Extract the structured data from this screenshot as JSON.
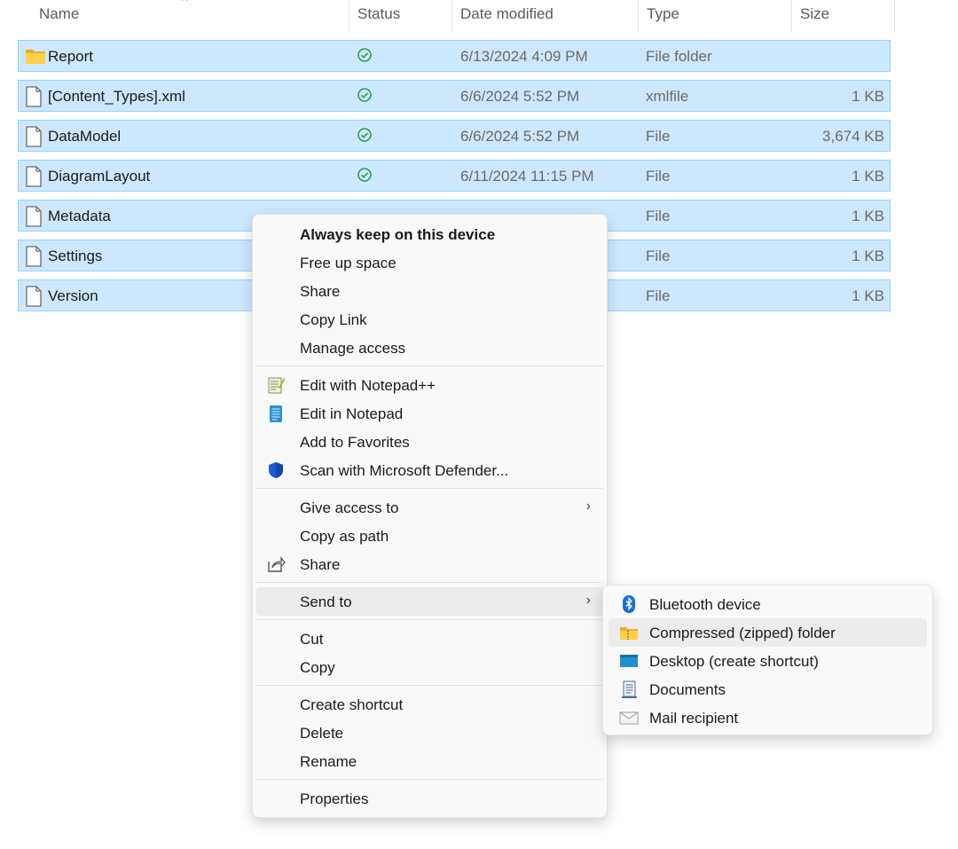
{
  "columns": {
    "name": "Name",
    "status": "Status",
    "date_modified": "Date modified",
    "type": "Type",
    "size": "Size"
  },
  "files": [
    {
      "name": "Report",
      "icon": "folder-icon",
      "date": "6/13/2024 4:09 PM",
      "type": "File folder",
      "size": ""
    },
    {
      "name": "[Content_Types].xml",
      "icon": "file-icon",
      "date": "6/6/2024 5:52 PM",
      "type": "xmlfile",
      "size": "1 KB"
    },
    {
      "name": "DataModel",
      "icon": "file-icon",
      "date": "6/6/2024 5:52 PM",
      "type": "File",
      "size": "3,674 KB"
    },
    {
      "name": "DiagramLayout",
      "icon": "file-icon",
      "date": "6/11/2024 11:15 PM",
      "type": "File",
      "size": "1 KB"
    },
    {
      "name": "Metadata",
      "icon": "file-icon",
      "date": "",
      "type": "File",
      "size": "1 KB"
    },
    {
      "name": "Settings",
      "icon": "file-icon",
      "date": "",
      "type": "File",
      "size": "1 KB"
    },
    {
      "name": "Version",
      "icon": "file-icon",
      "date": "",
      "type": "File",
      "size": "1 KB"
    }
  ],
  "context_menu": {
    "group1": [
      "Always keep on this device",
      "Free up space",
      "Share",
      "Copy Link",
      "Manage access"
    ],
    "group2": [
      "Edit with Notepad++",
      "Edit in Notepad",
      "Add to Favorites",
      "Scan with Microsoft Defender..."
    ],
    "group3": [
      "Give access to",
      "Copy as path",
      "Share"
    ],
    "send_to": "Send to",
    "group5": [
      "Cut",
      "Copy"
    ],
    "group6": [
      "Create shortcut",
      "Delete",
      "Rename"
    ],
    "properties": "Properties"
  },
  "send_to_submenu": [
    "Bluetooth device",
    "Compressed (zipped) folder",
    "Desktop (create shortcut)",
    "Documents",
    "Mail recipient"
  ],
  "colors": {
    "selection": "#cce8ff",
    "selection_border": "#99d1ff",
    "status_green": "#2e9e44",
    "defender_blue": "#1c5bd6",
    "bluetooth_blue": "#1a6fd8"
  }
}
